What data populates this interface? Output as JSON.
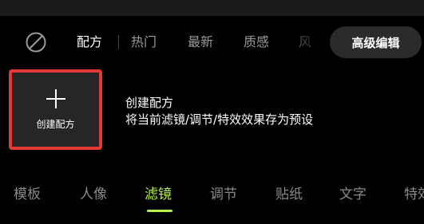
{
  "recipe_tabs": [
    "配方",
    "热门",
    "最新",
    "质感",
    "风"
  ],
  "advanced_edit_label": "高级编辑",
  "create_card": {
    "label": "创建配方"
  },
  "description": {
    "title": "创建配方",
    "subtitle": "将当前滤镜/调节/特效效果存为预设"
  },
  "bottom_tabs": [
    "模板",
    "人像",
    "滤镜",
    "调节",
    "贴纸",
    "文字",
    "特效"
  ],
  "active_bottom_tab": "滤镜",
  "active_recipe_tab": "配方",
  "colors": {
    "accent": "#b6f24a",
    "highlight_border": "#e53935",
    "background": "#000000"
  },
  "icons": [
    "no-filter-icon",
    "plus-icon"
  ]
}
